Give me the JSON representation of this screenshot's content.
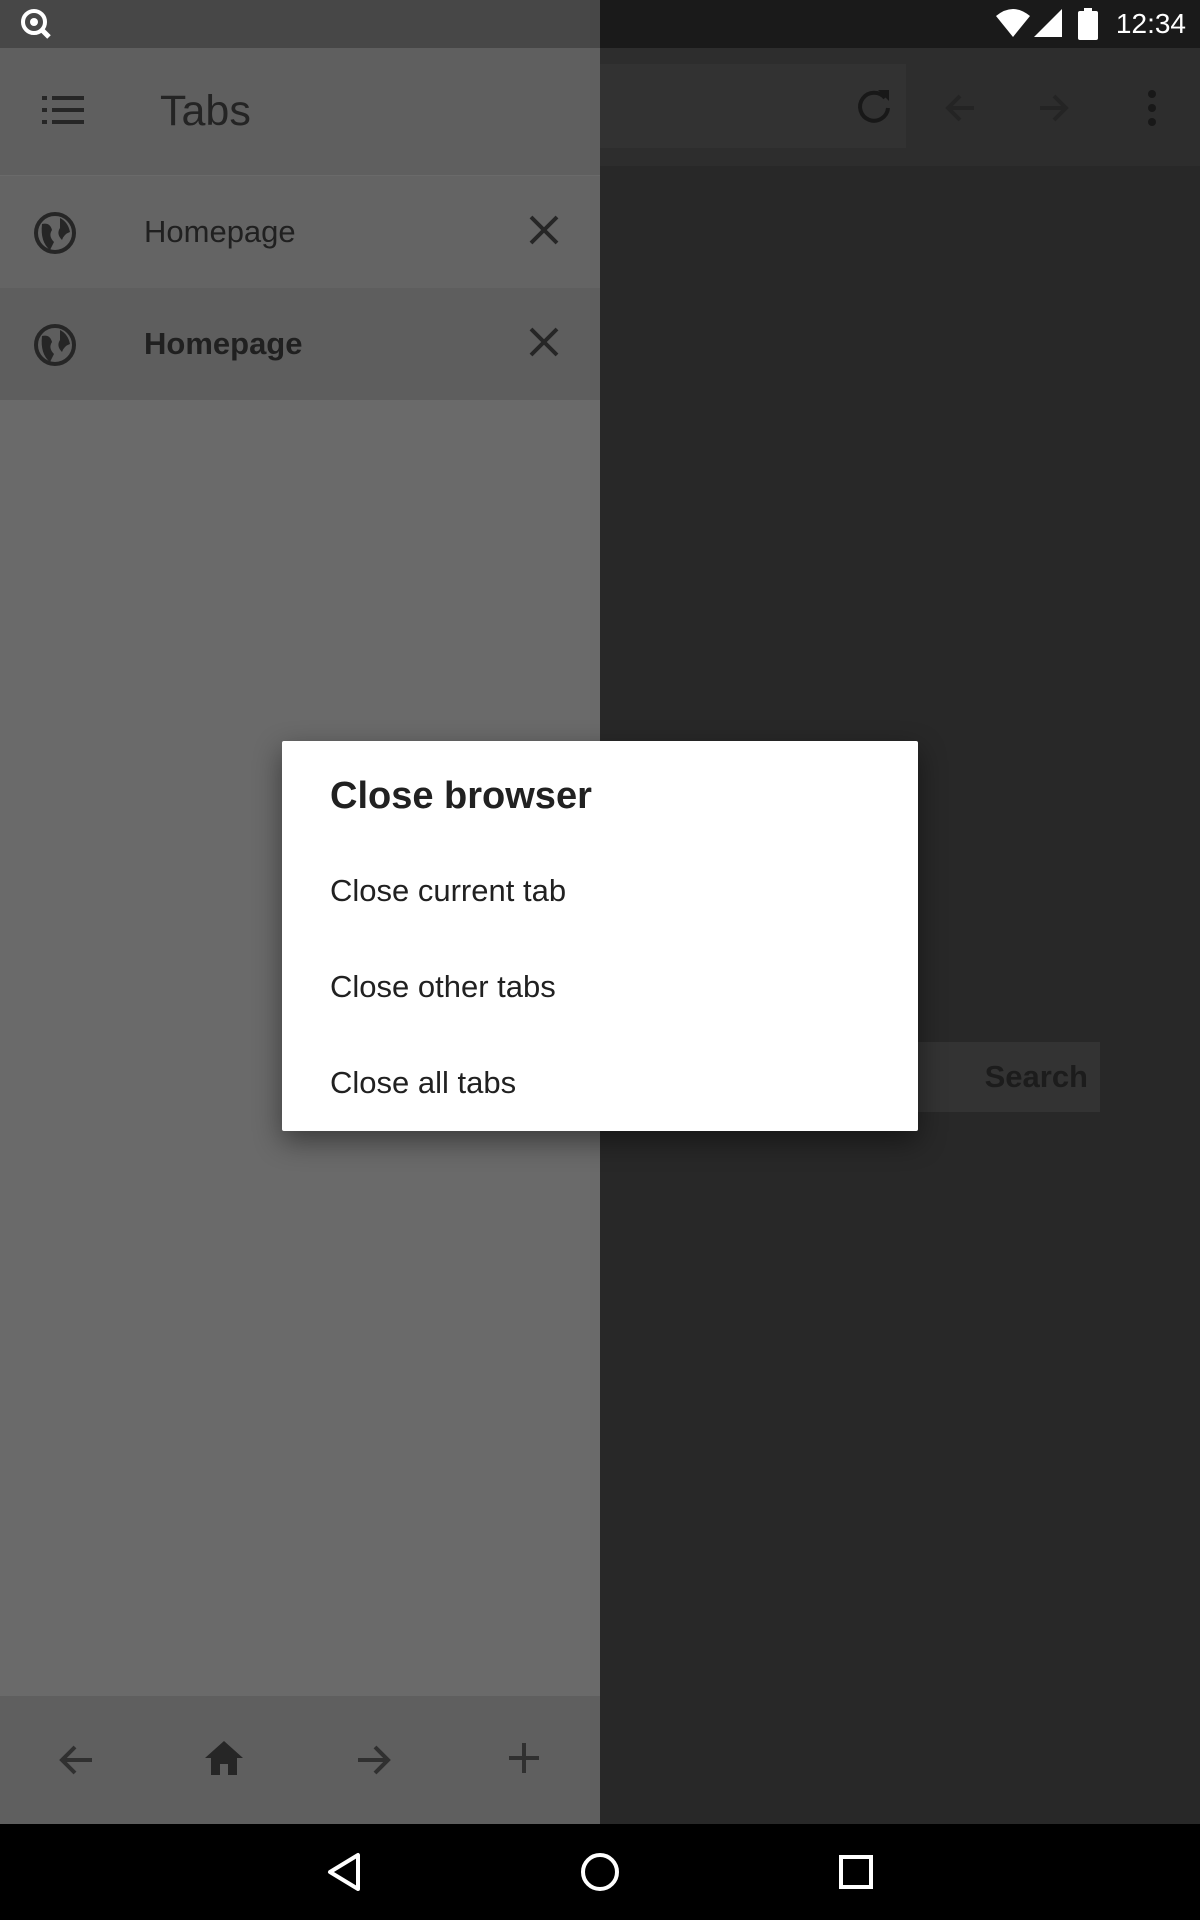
{
  "status_bar": {
    "time": "12:34"
  },
  "drawer": {
    "title": "Tabs",
    "tabs": [
      {
        "label": "Homepage",
        "active": false
      },
      {
        "label": "Homepage",
        "active": true
      }
    ]
  },
  "background_page": {
    "search_button": "Search"
  },
  "dialog": {
    "title": "Close browser",
    "options": [
      "Close current tab",
      "Close other tabs",
      "Close all tabs"
    ]
  },
  "icons": {
    "status_app": "search-app-icon",
    "wifi": "wifi-icon",
    "signal": "cell-signal-icon",
    "battery": "battery-icon",
    "reload": "reload-icon",
    "back": "arrow-back-icon",
    "forward": "arrow-forward-icon",
    "menu": "more-vert-icon",
    "tab_list": "list-icon",
    "globe": "globe-icon",
    "close": "close-icon",
    "home": "home-icon",
    "add": "add-icon"
  },
  "colors": {
    "drawer": "#6a6a6a",
    "scrim": "#282828",
    "dialog": "#ffffff"
  }
}
